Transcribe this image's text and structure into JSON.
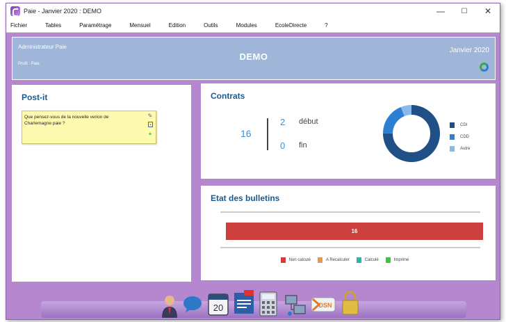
{
  "window": {
    "title": "Paie - Janvier 2020 : DEMO",
    "minimize": "—",
    "maximize": "☐",
    "close": "✕"
  },
  "menu": [
    "Fichier",
    "Tables",
    "Paramétrage",
    "Mensuel",
    "Edition",
    "Outils",
    "Modules",
    "EcoleDirecte",
    "?"
  ],
  "header": {
    "user": "Administrateur Paie",
    "profile": "Profil : Paie",
    "center": "DEMO",
    "period": "Janvier 2020"
  },
  "postit": {
    "title": "Post-it",
    "note": "Que pensez-vous de la nouvelle verion de Charlemagne paie ?"
  },
  "contrats": {
    "title": "Contrats",
    "total": "16",
    "debut_value": "2",
    "debut_label": "début",
    "fin_value": "0",
    "fin_label": "fin",
    "legend": [
      {
        "label": "CDI",
        "color": "#1f4f86"
      },
      {
        "label": "CDD",
        "color": "#2d7fd1"
      },
      {
        "label": "Autre",
        "color": "#8ab8ea"
      }
    ]
  },
  "chart_data": {
    "type": "pie",
    "series": [
      {
        "name": "CDI",
        "value": 12,
        "color": "#1f4f86"
      },
      {
        "name": "CDD",
        "value": 3,
        "color": "#2d7fd1"
      },
      {
        "name": "Autre",
        "value": 1,
        "color": "#8ab8ea"
      }
    ]
  },
  "etat": {
    "title": "Etat des bulletins",
    "bar_value": "16",
    "legend": [
      {
        "label": "Non calculé",
        "color": "#cc3f3f"
      },
      {
        "label": "A Recalculer",
        "color": "#e39a55"
      },
      {
        "label": "Calculé",
        "color": "#2fb5a8"
      },
      {
        "label": "Imprimé",
        "color": "#3cc43c"
      }
    ]
  },
  "dock": {
    "icons": [
      "user-icon",
      "chat-bubble-icon",
      "calendar-icon",
      "notice-icon",
      "calculator-icon",
      "network-icon",
      "dsn-icon",
      "lock-icon"
    ],
    "calendar_day": "20",
    "dsn_text": "DSN"
  }
}
